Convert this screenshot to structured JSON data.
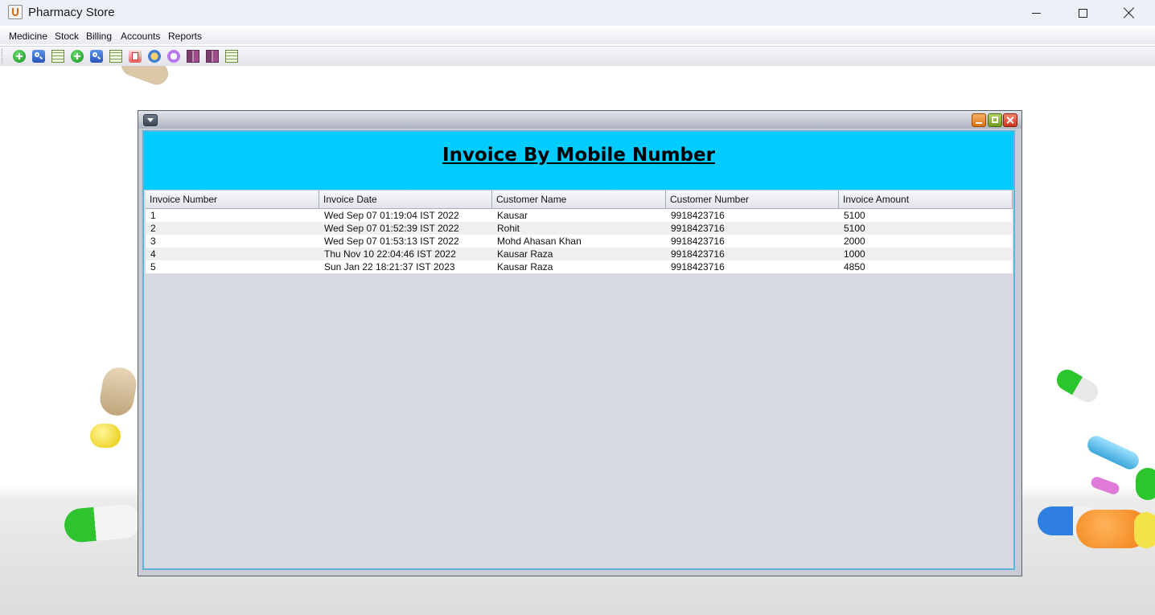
{
  "window": {
    "title": "Pharmacy Store"
  },
  "menubar": {
    "items": [
      "Medicine",
      "Stock",
      "Billing",
      "Accounts",
      "Reports"
    ]
  },
  "toolbar": {
    "icons": [
      "add-medicine-icon",
      "search-medicine-icon",
      "view-medicine-table-icon",
      "add-stock-icon",
      "search-stock-icon",
      "view-stock-table-icon",
      "new-bill-icon",
      "accounts-icon",
      "reports-icon",
      "report-book-icon",
      "report-book-icon",
      "view-table-icon"
    ]
  },
  "internal_frame": {
    "heading": "Invoice By Mobile Number",
    "heading_bg": "#00ccff",
    "table": {
      "columns": [
        "Invoice Number",
        "Invoice Date",
        "Customer Name",
        "Customer Number",
        "Invoice Amount"
      ],
      "rows": [
        [
          "1",
          "Wed Sep 07 01:19:04 IST 2022",
          "Kausar",
          "9918423716",
          "5100"
        ],
        [
          "2",
          "Wed Sep 07 01:52:39 IST 2022",
          "Rohit",
          "9918423716",
          "5100"
        ],
        [
          "3",
          "Wed Sep 07 01:53:13 IST 2022",
          "Mohd Ahasan Khan",
          "9918423716",
          "2000"
        ],
        [
          "4",
          "Thu Nov 10 22:04:46 IST 2022",
          "Kausar Raza",
          "9918423716",
          "1000"
        ],
        [
          "5",
          "Sun Jan 22 18:21:37 IST 2023",
          "Kausar Raza",
          "9918423716",
          "4850"
        ]
      ]
    }
  }
}
